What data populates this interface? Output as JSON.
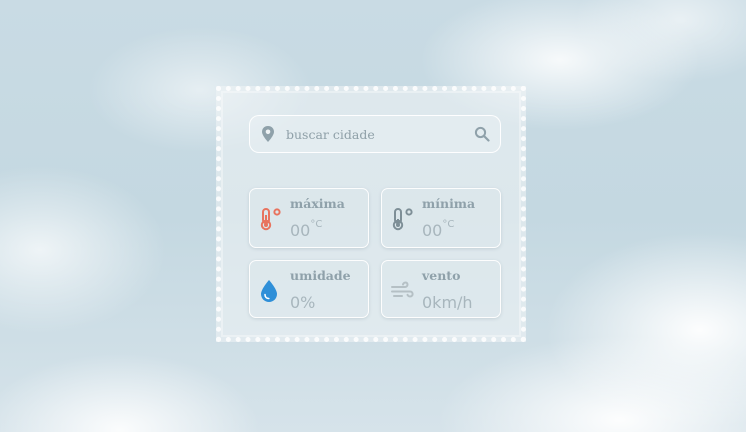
{
  "search": {
    "placeholder": "buscar cidade",
    "value": ""
  },
  "tiles": {
    "max": {
      "label": "máxima",
      "value": "00",
      "unit": "°C",
      "icon": "thermometer-hot-icon",
      "color": "#e8735e"
    },
    "min": {
      "label": "mínima",
      "value": "00",
      "unit": "°C",
      "icon": "thermometer-cold-icon",
      "color": "#7e8f97"
    },
    "humidity": {
      "label": "umidade",
      "value": "0%",
      "icon": "water-drop-icon",
      "color": "#2f8fd8"
    },
    "wind": {
      "label": "vento",
      "value": "0km/h",
      "icon": "wind-icon",
      "color": "#b5c0c5"
    }
  },
  "colors": {
    "accent": "#8fa1aa",
    "card": "rgba(240,244,246,0.55)"
  }
}
